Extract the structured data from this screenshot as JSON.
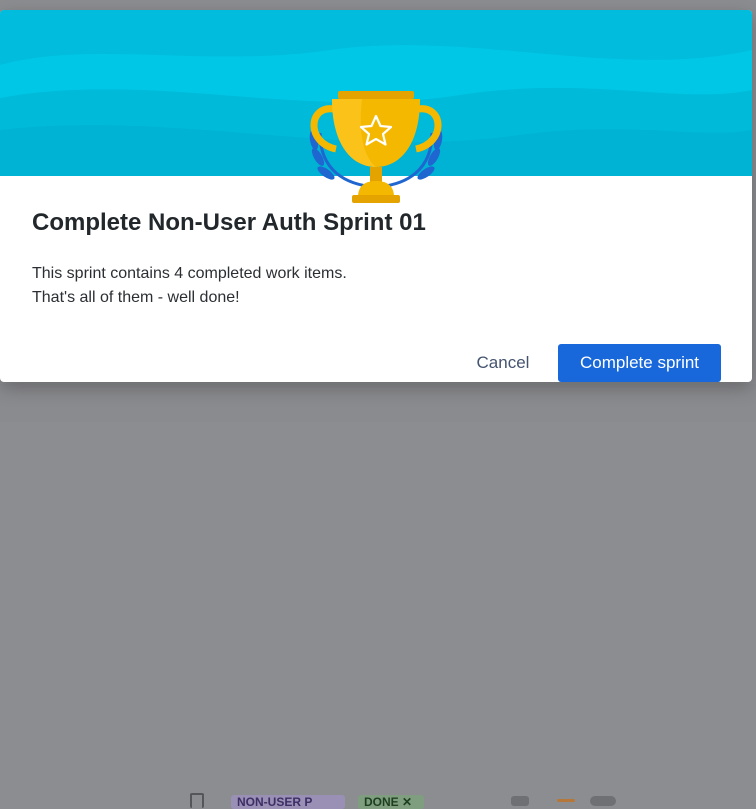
{
  "background": {
    "tags": [
      "NON-USER P",
      "DONE ✕"
    ]
  },
  "dialog": {
    "title": "Complete Non-User Auth Sprint 01",
    "body_line1": "This sprint contains 4 completed work items.",
    "body_line2": "That's all of them - well done!",
    "cancel_label": "Cancel",
    "confirm_label": "Complete sprint"
  },
  "colors": {
    "hero": "#00c7e6",
    "primary_button": "#1868db",
    "trophy": "#f5b800"
  }
}
